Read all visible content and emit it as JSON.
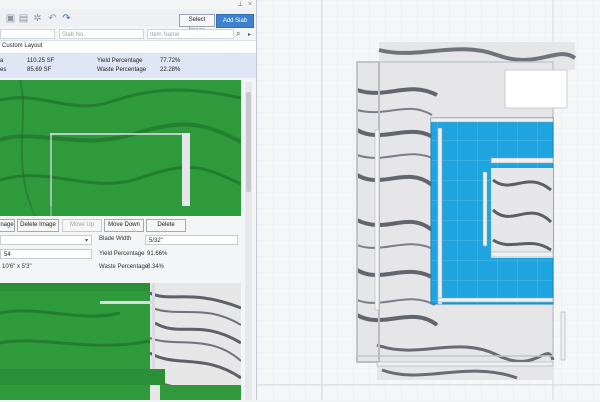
{
  "toolbar": {
    "select_image_label": "Select Image",
    "add_slab_label": "Add Slab",
    "icons": [
      "image-icon",
      "slab-icon",
      "settings-icon",
      "undo-icon",
      "redo-icon"
    ]
  },
  "filters": {
    "slab_no_placeholder": "Slab No.",
    "item_name_placeholder": "Item Name"
  },
  "layout_name": "Custom Layout",
  "stats": {
    "row1_label_tail": "a",
    "total": "110.25 SF",
    "yield_label": "Yield Percentage",
    "yield_value": "77.72%",
    "row2_label_tail": "es",
    "waste": "85.69 SF",
    "waste_label": "Waste Percentage",
    "waste_value": "22.28%"
  },
  "actions": {
    "change_image_tail": "nage",
    "delete_image": "Delete Image",
    "move_up": "Move Up",
    "move_down": "Move Down",
    "delete": "Delete"
  },
  "form": {
    "blade_width_label": "Blade Width",
    "blade_width_value": "5/32\"",
    "count_value": "54",
    "yield_label": "Yield Percentage",
    "yield_value": "91.66%",
    "size_value": "10'6\" x 5'3\"",
    "waste_label": "Waste Percentage",
    "waste_value": "8.34%"
  },
  "colors": {
    "accent": "#3e82cf",
    "slab_green": "#2e9a3c",
    "piece_blue": "#1fa4e0"
  }
}
